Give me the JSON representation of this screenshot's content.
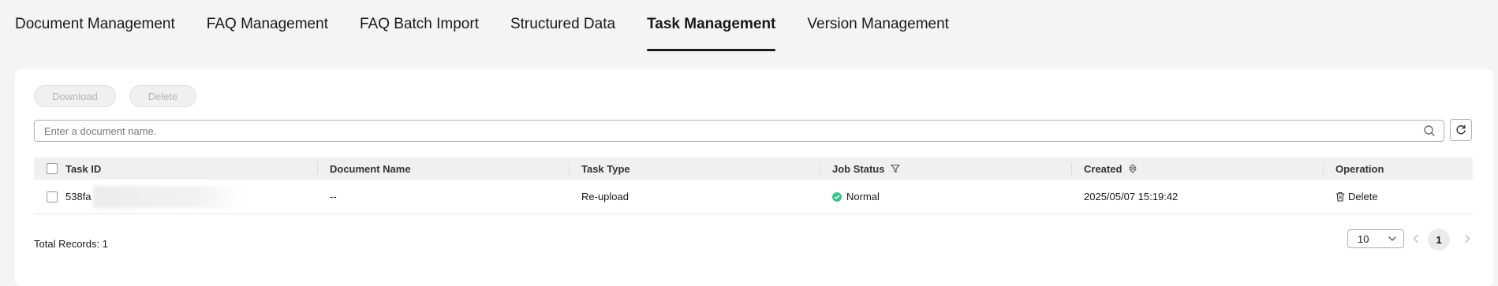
{
  "tabs": [
    {
      "label": "Document Management"
    },
    {
      "label": "FAQ Management"
    },
    {
      "label": "FAQ Batch Import"
    },
    {
      "label": "Structured Data"
    },
    {
      "label": "Task Management",
      "active": true
    },
    {
      "label": "Version Management"
    }
  ],
  "toolbar": {
    "download_label": "Download",
    "delete_label": "Delete"
  },
  "search": {
    "placeholder": "Enter a document name.",
    "value": ""
  },
  "table": {
    "columns": [
      "Task ID",
      "Document Name",
      "Task Type",
      "Job Status",
      "Created",
      "Operation"
    ],
    "rows": [
      {
        "task_id": "538fa",
        "document_name": "--",
        "task_type": "Re-upload",
        "job_status": "Normal",
        "created": "2025/05/07 15:19:42",
        "operation": "Delete"
      }
    ]
  },
  "footer": {
    "total_records": "Total Records: 1",
    "page_size": "10",
    "current_page": "1"
  },
  "colors": {
    "status_normal": "#3ec28f",
    "active_tab_underline": "#191919"
  }
}
